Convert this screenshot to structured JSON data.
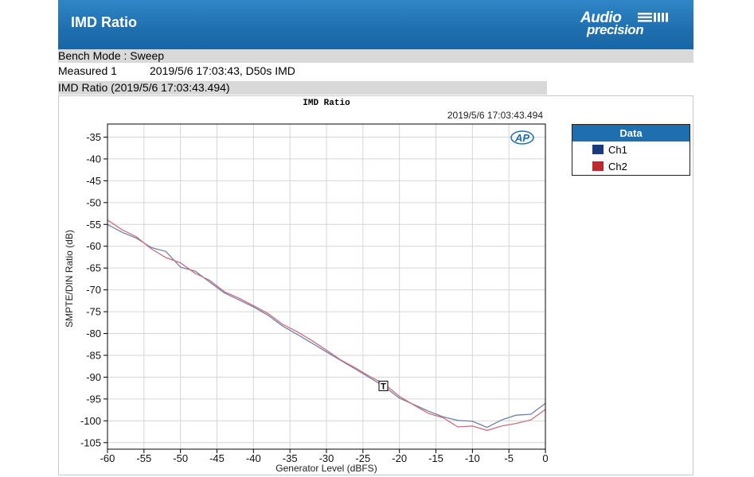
{
  "header": {
    "title": "IMD Ratio",
    "logo_line1": "Audio",
    "logo_line2": "precision"
  },
  "info": {
    "bench_mode": "Bench Mode : Sweep",
    "measured_label": "Measured 1",
    "measured_value": "2019/5/6 17:03:43, D50s IMD",
    "imd_ratio_row": "IMD Ratio (2019/5/6 17:03:43.494)"
  },
  "legend": {
    "title": "Data",
    "items": [
      {
        "label": "Ch1",
        "color": "#1a3a7c"
      },
      {
        "label": "Ch2",
        "color": "#c0282d"
      }
    ]
  },
  "chart_data": {
    "type": "line",
    "title": "IMD Ratio",
    "subtitle": "2019/5/6 17:03:43.494",
    "xlabel": "Generator Level (dBFS)",
    "ylabel": "SMPTE/DIN Ratio (dB)",
    "xlim": [
      -60,
      0
    ],
    "ylim": [
      -106.5,
      -32
    ],
    "xticks": [
      -60,
      -55,
      -50,
      -45,
      -40,
      -35,
      -30,
      -25,
      -20,
      -15,
      -10,
      -5,
      0
    ],
    "yticks": [
      -35,
      -40,
      -45,
      -50,
      -55,
      -60,
      -65,
      -70,
      -75,
      -80,
      -85,
      -90,
      -95,
      -100,
      -105
    ],
    "grid": true,
    "legend_position": "right",
    "badge": "AP",
    "marker": {
      "label": "T",
      "x": -22.2,
      "y": -92
    },
    "series": [
      {
        "name": "Ch1",
        "color": "#7181a8",
        "x": [
          -60,
          -58,
          -56,
          -54,
          -52,
          -50,
          -48,
          -46,
          -44,
          -42,
          -40,
          -38,
          -36,
          -34,
          -32,
          -30,
          -28,
          -26,
          -24,
          -22.2,
          -20,
          -18,
          -16,
          -14,
          -12,
          -10,
          -8,
          -6,
          -4,
          -2,
          0
        ],
        "y": [
          -55,
          -56.8,
          -58.2,
          -60.3,
          -61.2,
          -64.8,
          -65.7,
          -68.2,
          -70.7,
          -72.3,
          -73.9,
          -75.8,
          -78.3,
          -80.2,
          -82.2,
          -84.2,
          -86.2,
          -88.2,
          -90.2,
          -92,
          -94.8,
          -96.3,
          -97.8,
          -99.1,
          -99.9,
          -100.1,
          -101.5,
          -99.8,
          -98.7,
          -98.5,
          -96
        ]
      },
      {
        "name": "Ch2",
        "color": "#c9707a",
        "x": [
          -60,
          -58,
          -56,
          -54,
          -52,
          -50,
          -48,
          -46,
          -44,
          -42,
          -40,
          -38,
          -36,
          -34,
          -32,
          -30,
          -28,
          -26,
          -24,
          -22.2,
          -20,
          -18,
          -16,
          -14,
          -12,
          -10,
          -8,
          -6,
          -4,
          -2,
          0
        ],
        "y": [
          -54,
          -56.2,
          -57.9,
          -60.6,
          -62.6,
          -63.8,
          -66.2,
          -67.8,
          -70.4,
          -71.9,
          -73.6,
          -75.4,
          -77.9,
          -79.6,
          -81.6,
          -83.8,
          -86.1,
          -87.9,
          -89.9,
          -91.4,
          -94.4,
          -96.4,
          -98.3,
          -99.3,
          -101.4,
          -101.2,
          -102.2,
          -101.2,
          -100.6,
          -99.8,
          -97.4
        ]
      }
    ]
  }
}
